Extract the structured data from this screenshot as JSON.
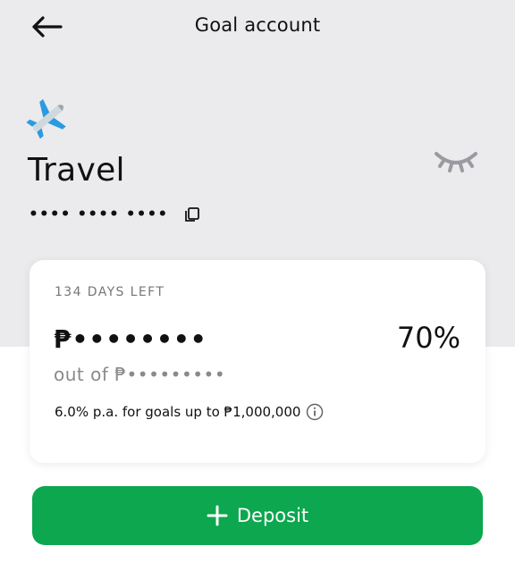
{
  "header": {
    "title": "Goal account"
  },
  "goal": {
    "emoji_icon": "airplane-icon",
    "name": "Travel",
    "account_number_masked": "•••• •••• ••••"
  },
  "card": {
    "days_left": "134 DAYS LEFT",
    "saved_amount_masked": "₱••••••••",
    "progress_percent": "70%",
    "target_amount_masked": "out of ₱•••••••••",
    "interest_info": "6.0% p.a. for goals up to ₱1,000,000"
  },
  "actions": {
    "deposit_label": "Deposit"
  },
  "colors": {
    "header_bg": "#ebebed",
    "card_bg": "#ffffff",
    "primary_green": "#0ca74e",
    "muted_text": "#8a8a8a"
  }
}
